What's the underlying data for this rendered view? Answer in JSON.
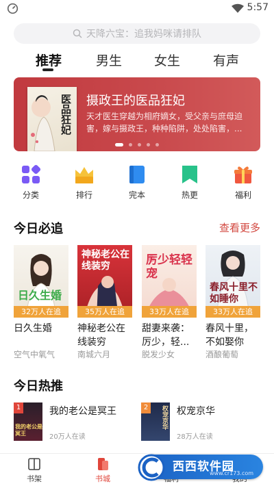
{
  "status_bar": {
    "time": "5:57"
  },
  "search": {
    "placeholder_text": "天降六宝：追我妈咪请排队"
  },
  "tabs": [
    {
      "label": "推荐",
      "active": true
    },
    {
      "label": "男生",
      "active": false
    },
    {
      "label": "女生",
      "active": false
    },
    {
      "label": "有声",
      "active": false
    }
  ],
  "banner": {
    "title": "摄政王的医品狂妃",
    "description": "天才医生穿越为相府嫡女，受父亲与庶母迫害，嫁与摄政王，种种陷阱，处处陷害，...",
    "cover_text": "医品狂妃",
    "page_count": 5,
    "active_page": 1
  },
  "categories": [
    {
      "label": "分类",
      "icon": "grid-icon"
    },
    {
      "label": "排行",
      "icon": "crown-icon"
    },
    {
      "label": "完本",
      "icon": "book-icon"
    },
    {
      "label": "热更",
      "icon": "bookmark-icon"
    },
    {
      "label": "福利",
      "icon": "gift-icon"
    }
  ],
  "today_picks": {
    "title": "今日必追",
    "see_more": "查看更多",
    "books": [
      {
        "cover_text": "日久生婚",
        "badge": "32万人在追",
        "title": "日久生婚",
        "author": "空气中氧气"
      },
      {
        "cover_text": "神秘老公在线装穷",
        "badge": "35万人在追",
        "title": "神秘老公在线装穷",
        "author": "南城六月"
      },
      {
        "cover_text": "厉少轻轻宠",
        "badge": "33万人在追",
        "title": "甜妻来袭：厉少，轻...",
        "author": "脱发少女"
      },
      {
        "cover_text": "春风十里不如睡你",
        "badge": "33万人在追",
        "title": "春风十里，不如娶你",
        "author": "酒酿葡萄"
      }
    ]
  },
  "today_hot": {
    "title": "今日热推",
    "items": [
      {
        "rank": "1",
        "title": "我的老公是冥王",
        "readers": "20万人在读",
        "cover_text": "我的老公是冥王"
      },
      {
        "rank": "2",
        "title": "权宠京华",
        "readers": "28万人在读",
        "cover_text": "权宠京华"
      }
    ]
  },
  "bottom_nav": [
    {
      "label": "书架",
      "icon": "bookshelf-icon",
      "active": false
    },
    {
      "label": "书城",
      "icon": "bookstore-icon",
      "active": true
    },
    {
      "label": "福利",
      "icon": "gift-icon",
      "active": false
    },
    {
      "label": "我的",
      "icon": "user-icon",
      "active": false
    }
  ],
  "watermark": {
    "text": "西西软件园",
    "url": "www.cr173.com"
  },
  "colors": {
    "accent": "#d2473f",
    "badge": "#f0a33a",
    "banner": "#c13a3f"
  }
}
